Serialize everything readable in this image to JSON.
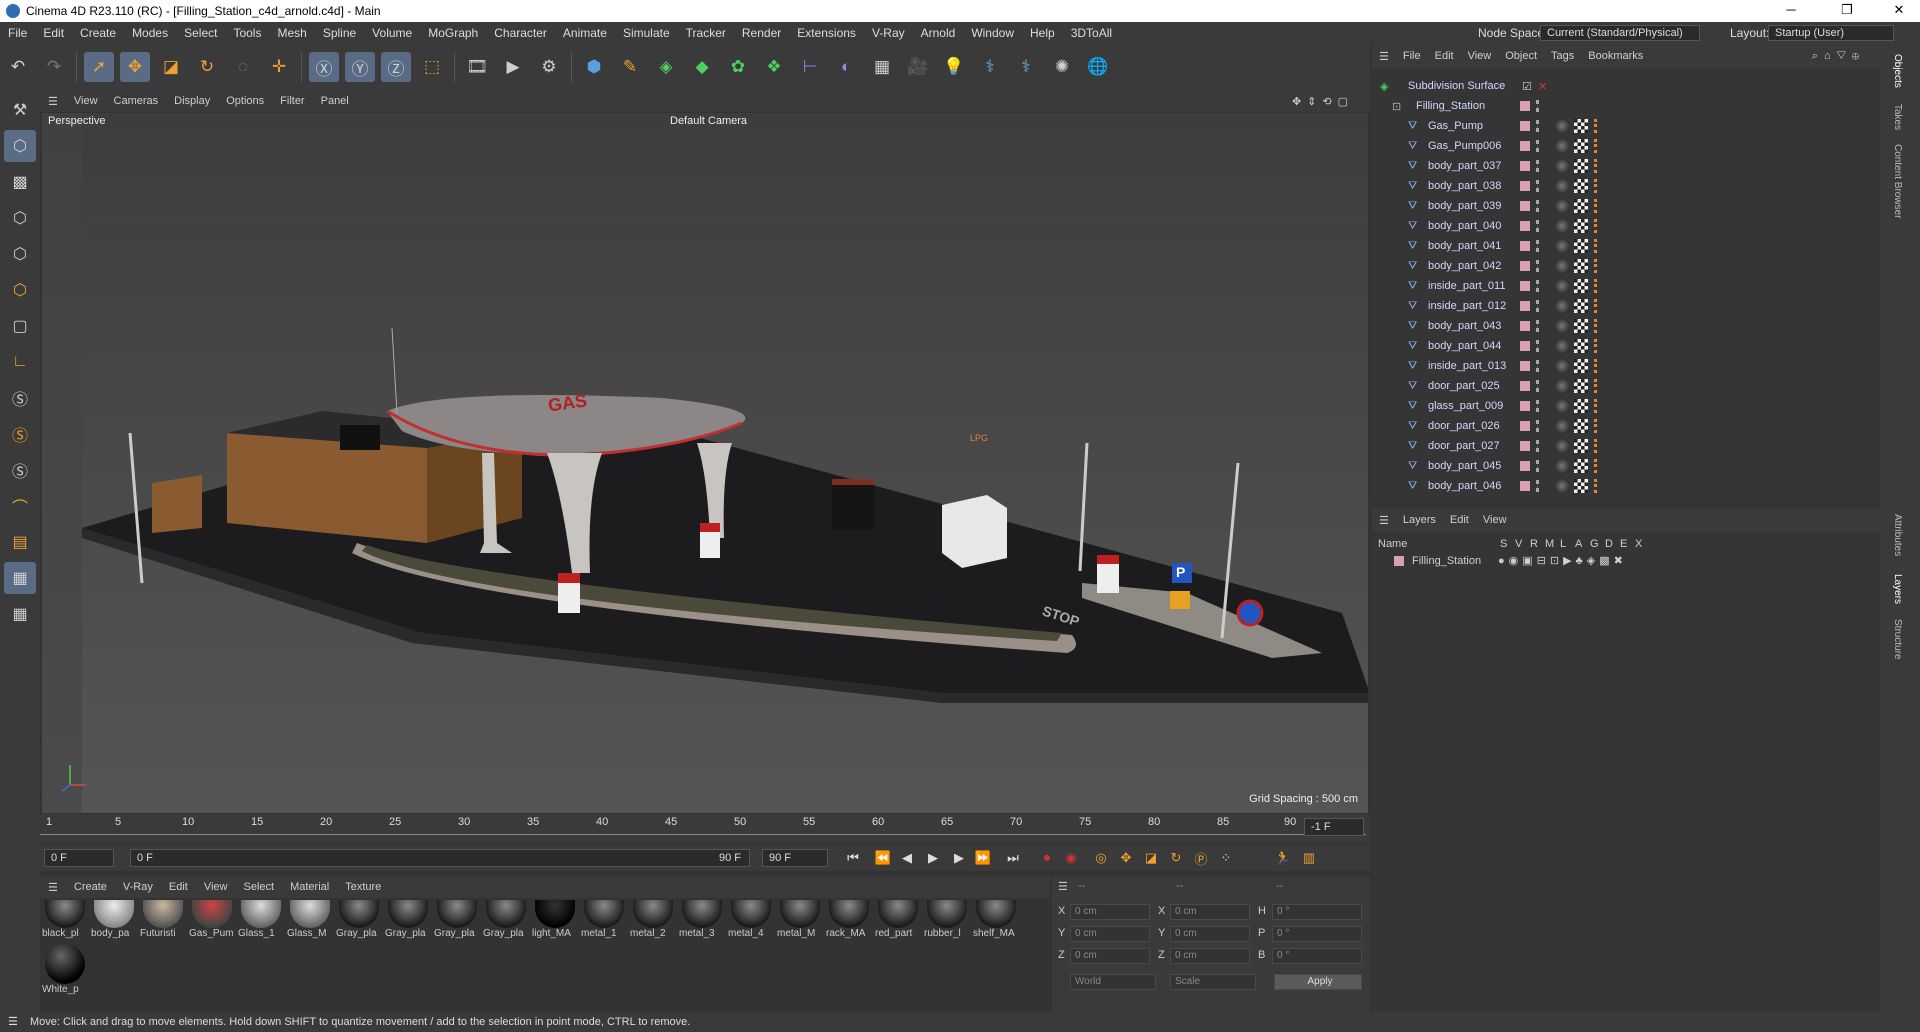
{
  "window": {
    "title": "Cinema 4D R23.110 (RC) - [Filling_Station_c4d_arnold.c4d] - Main"
  },
  "menubar": {
    "items": [
      "File",
      "Edit",
      "Create",
      "Modes",
      "Select",
      "Tools",
      "Mesh",
      "Spline",
      "Volume",
      "MoGraph",
      "Character",
      "Animate",
      "Simulate",
      "Tracker",
      "Render",
      "Extensions",
      "V-Ray",
      "Arnold",
      "Window",
      "Help",
      "3DToAll"
    ],
    "node_space_label": "Node Space:",
    "node_space_value": "Current (Standard/Physical)",
    "layout_label": "Layout:",
    "layout_value": "Startup (User)"
  },
  "viewport": {
    "menu": [
      "View",
      "Cameras",
      "Display",
      "Options",
      "Filter",
      "Panel"
    ],
    "label": "Perspective",
    "camera": "Default Camera",
    "grid_spacing": "Grid Spacing : 500 cm",
    "sign_gas": "GAS",
    "sign_lpg": "LPG",
    "sign_stop": "STOP",
    "sign_p": "P"
  },
  "timeline": {
    "ticks": [
      "1",
      "5",
      "10",
      "15",
      "20",
      "25",
      "30",
      "35",
      "40",
      "45",
      "50",
      "55",
      "60",
      "65",
      "70",
      "75",
      "80",
      "85",
      "90"
    ],
    "current": "-1 F"
  },
  "playbar": {
    "start": "0 F",
    "range_start": "0 F",
    "range_end": "90 F",
    "end": "90 F"
  },
  "materials": {
    "menu": [
      "Create",
      "V-Ray",
      "Edit",
      "View",
      "Select",
      "Material",
      "Texture"
    ],
    "items": [
      "black_pl",
      "body_pa",
      "Futuristi",
      "Gas_Pum",
      "Glass_1",
      "Glass_M",
      "Gray_pla",
      "Gray_pla",
      "Gray_pla",
      "Gray_pla",
      "light_MA",
      "metal_1",
      "metal_2",
      "metal_3",
      "metal_4",
      "metal_M",
      "rack_MA",
      "red_part",
      "rubber_l",
      "shelf_MA",
      "White_p"
    ]
  },
  "coords": {
    "header": [
      "--",
      "--",
      "--"
    ],
    "rows": [
      {
        "a": "X",
        "av": "0 cm",
        "b": "X",
        "bv": "0 cm",
        "c": "H",
        "cv": "0 °"
      },
      {
        "a": "Y",
        "av": "0 cm",
        "b": "Y",
        "bv": "0 cm",
        "c": "P",
        "cv": "0 °"
      },
      {
        "a": "Z",
        "av": "0 cm",
        "b": "Z",
        "bv": "0 cm",
        "c": "B",
        "cv": "0 °"
      }
    ],
    "world": "World",
    "scale": "Scale",
    "apply": "Apply"
  },
  "objects": {
    "menu": [
      "File",
      "Edit",
      "View",
      "Object",
      "Tags",
      "Bookmarks"
    ],
    "root": "Subdivision Surface",
    "group": "Filling_Station",
    "items": [
      "Gas_Pump",
      "Gas_Pump006",
      "body_part_037",
      "body_part_038",
      "body_part_039",
      "body_part_040",
      "body_part_041",
      "body_part_042",
      "inside_part_011",
      "inside_part_012",
      "body_part_043",
      "body_part_044",
      "inside_part_013",
      "door_part_025",
      "glass_part_009",
      "door_part_026",
      "door_part_027",
      "body_part_045",
      "body_part_046"
    ]
  },
  "layers": {
    "menu": [
      "Layers",
      "Edit",
      "View"
    ],
    "columns": [
      "Name",
      "S",
      "V",
      "R",
      "M",
      "L",
      "A",
      "G",
      "D",
      "E",
      "X"
    ],
    "row": "Filling_Station"
  },
  "sidetabs": [
    "Objects",
    "Takes",
    "Content Browser",
    "Attributes",
    "Layers",
    "Structure"
  ],
  "status": "Move: Click and drag to move elements. Hold down SHIFT to quantize movement / add to the selection in point mode, CTRL to remove."
}
